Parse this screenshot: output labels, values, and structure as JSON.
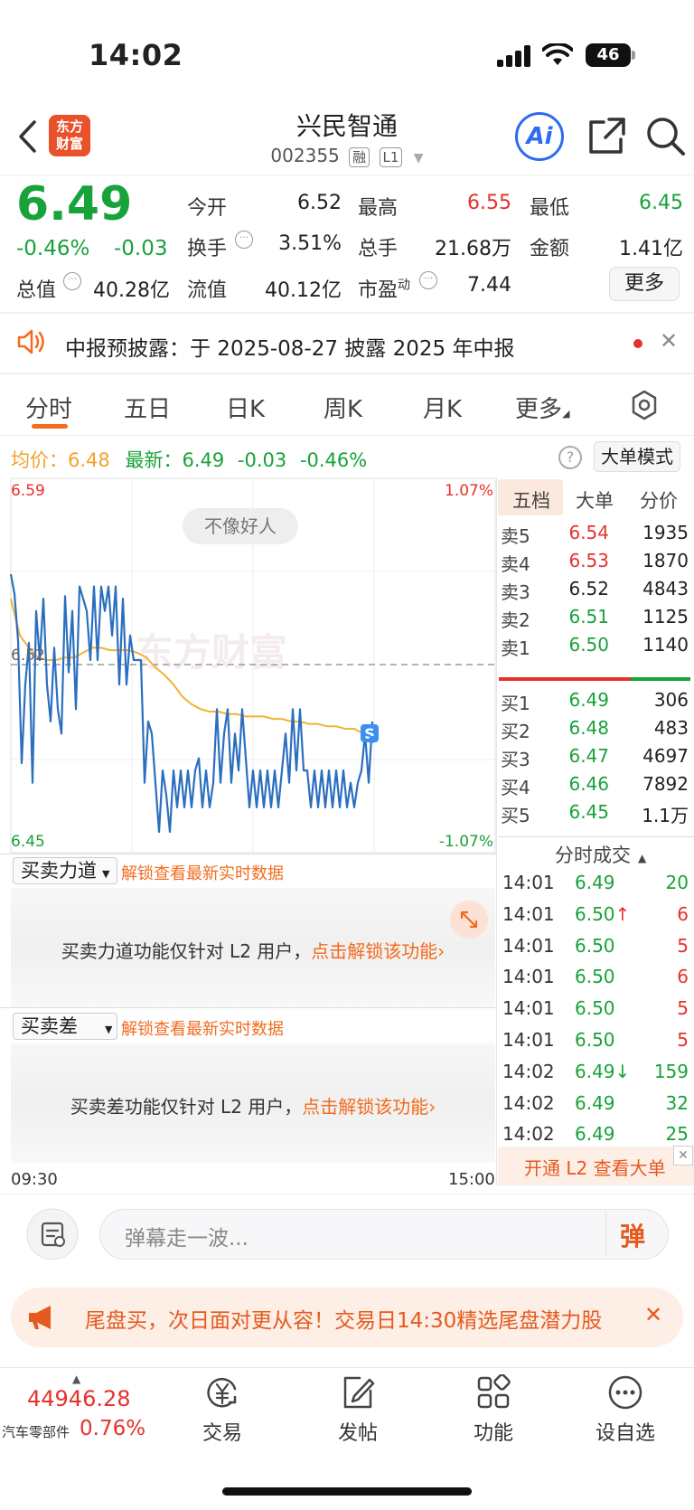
{
  "status_bar": {
    "time": "14:02",
    "battery": "46"
  },
  "header": {
    "logo_line1": "东方",
    "logo_line2": "财富",
    "stock_name": "兴民智通",
    "stock_code": "002355",
    "tag_margin": "融",
    "tag_level": "L1",
    "ai_label": "Ai"
  },
  "quote": {
    "price": "6.49",
    "change_pct": "-0.46%",
    "change_amt": "-0.03",
    "open_label": "今开",
    "open": "6.52",
    "high_label": "最高",
    "high": "6.55",
    "low_label": "最低",
    "low": "6.45",
    "turnover_label": "换手",
    "turnover": "3.51%",
    "volume_label": "总手",
    "volume": "21.68万",
    "amount_label": "金额",
    "amount": "1.41亿",
    "mktcap_label": "总值",
    "mktcap": "40.28亿",
    "float_label": "流值",
    "float": "40.12亿",
    "pe_label": "市盈",
    "pe_sup": "动",
    "pe": "7.44",
    "more_label": "更多"
  },
  "notice": {
    "text": "中报预披露：于 2025-08-27 披露 2025 年中报"
  },
  "tabs": [
    "分时",
    "五日",
    "日K",
    "周K",
    "月K",
    "更多"
  ],
  "chart_info": {
    "avg_label": "均价：",
    "avg": "6.48",
    "latest_label": "最新：",
    "latest": "6.49",
    "latest_chg": "-0.03",
    "latest_pct": "-0.46%",
    "help": "?",
    "big_order_mode": "大单模式"
  },
  "chart_data": {
    "type": "line",
    "ylim": [
      6.45,
      6.59
    ],
    "y_top_label": "6.59",
    "y_bottom_label": "6.45",
    "pct_top_label": "1.07%",
    "pct_bottom_label": "-1.07%",
    "prev_close_label": "6.52",
    "x_start_label": "09:30",
    "x_end_label": "15:00",
    "watermark": "东方财富",
    "bubble": "不像好人",
    "marker": "S",
    "series": [
      {
        "values": [
          6.555,
          6.547,
          6.528,
          6.478,
          6.51,
          6.527,
          6.47,
          6.54,
          6.52,
          6.545,
          6.51,
          6.495,
          6.525,
          6.5,
          6.49,
          6.546,
          6.515,
          6.54,
          6.5,
          6.55,
          6.545,
          6.54,
          6.52,
          6.55,
          6.52,
          6.55,
          6.54,
          6.55,
          6.53,
          6.55,
          6.51,
          6.545,
          6.51,
          6.53,
          6.52,
          6.52,
          6.52,
          6.47,
          6.495,
          6.49,
          6.47,
          6.45,
          6.475,
          6.465,
          6.45,
          6.475,
          6.46,
          6.475,
          6.46,
          6.475,
          6.46,
          6.475,
          6.48,
          6.46,
          6.475,
          6.46,
          6.47,
          6.5,
          6.47,
          6.49,
          6.5,
          6.47,
          6.49,
          6.475,
          6.5,
          6.48,
          6.46,
          6.475,
          6.46,
          6.475,
          6.46,
          6.475,
          6.46,
          6.475,
          6.46,
          6.475,
          6.49,
          6.47,
          6.5,
          6.475,
          6.5,
          6.475,
          6.475,
          6.46,
          6.475,
          6.46,
          6.475,
          6.46,
          6.475,
          6.46,
          6.475,
          6.46,
          6.475,
          6.46,
          6.47,
          6.46,
          6.47,
          6.475,
          6.49,
          6.47,
          6.495
        ]
      },
      {
        "values": [
          6.545,
          6.53,
          6.525,
          6.521,
          6.52,
          6.52,
          6.521,
          6.521,
          6.523,
          6.525,
          6.525,
          6.524,
          6.524,
          6.524,
          6.523,
          6.521,
          6.517,
          6.514,
          6.51,
          6.505,
          6.502,
          6.5,
          6.499,
          6.499,
          6.498,
          6.498,
          6.497,
          6.497,
          6.497,
          6.496,
          6.496,
          6.495,
          6.495,
          6.494,
          6.494,
          6.493,
          6.493,
          6.492,
          6.492,
          6.49,
          6.49
        ]
      }
    ]
  },
  "order_book": {
    "tabs": [
      "五档",
      "大单",
      "分价"
    ],
    "asks": [
      {
        "label": "卖5",
        "price": "6.54",
        "vol": "1935",
        "color": "#e5322d"
      },
      {
        "label": "卖4",
        "price": "6.53",
        "vol": "1870",
        "color": "#e5322d"
      },
      {
        "label": "卖3",
        "price": "6.52",
        "vol": "4843",
        "color": "#222222"
      },
      {
        "label": "卖2",
        "price": "6.51",
        "vol": "1125",
        "color": "#18a23a"
      },
      {
        "label": "卖1",
        "price": "6.50",
        "vol": "1140",
        "color": "#18a23a"
      }
    ],
    "bids": [
      {
        "label": "买1",
        "price": "6.49",
        "vol": "306",
        "color": "#18a23a"
      },
      {
        "label": "买2",
        "price": "6.48",
        "vol": "483",
        "color": "#18a23a"
      },
      {
        "label": "买3",
        "price": "6.47",
        "vol": "4697",
        "color": "#18a23a"
      },
      {
        "label": "买4",
        "price": "6.46",
        "vol": "7892",
        "color": "#18a23a"
      },
      {
        "label": "买5",
        "price": "6.45",
        "vol": "1.1万",
        "color": "#18a23a"
      }
    ],
    "ticks_title": "分时成交",
    "ticks": [
      {
        "time": "14:01",
        "price": "6.49",
        "vol": "20",
        "vcolor": "#18a23a"
      },
      {
        "time": "14:01",
        "price": "6.50↑",
        "vol": "6",
        "vcolor": "#e5322d"
      },
      {
        "time": "14:01",
        "price": "6.50",
        "vol": "5",
        "vcolor": "#e5322d"
      },
      {
        "time": "14:01",
        "price": "6.50",
        "vol": "6",
        "vcolor": "#e5322d"
      },
      {
        "time": "14:01",
        "price": "6.50",
        "vol": "5",
        "vcolor": "#e5322d"
      },
      {
        "time": "14:01",
        "price": "6.50",
        "vol": "5",
        "vcolor": "#e5322d"
      },
      {
        "time": "14:02",
        "price": "6.49↓",
        "vol": "159",
        "vcolor": "#18a23a"
      },
      {
        "time": "14:02",
        "price": "6.49",
        "vol": "32",
        "vcolor": "#18a23a"
      },
      {
        "time": "14:02",
        "price": "6.49",
        "vol": "25",
        "vcolor": "#18a23a"
      }
    ],
    "l2_banner": "开通 L2 查看大单"
  },
  "l2_panels": {
    "p1_select": "买卖力道",
    "p1_link": "解锁查看最新实时数据",
    "p1_msg": "买卖力道功能仅针对 L2 用户，",
    "p1_action": "点击解锁该功能",
    "p2_select": "买卖差",
    "p2_link": "解锁查看最新实时数据",
    "p2_msg": "买卖差功能仅针对 L2 用户，",
    "p2_action": "点击解锁该功能"
  },
  "comment": {
    "placeholder": "弹幕走一波...",
    "send": "弹"
  },
  "promo": {
    "text": "尾盘买，次日面对更从容！交易日14:30精选尾盘潜力股"
  },
  "bottom_nav": {
    "index_value": "44946.28",
    "index_name": "汽车零部件",
    "index_pct": "0.76%",
    "items": [
      "交易",
      "发帖",
      "功能",
      "设自选"
    ]
  }
}
